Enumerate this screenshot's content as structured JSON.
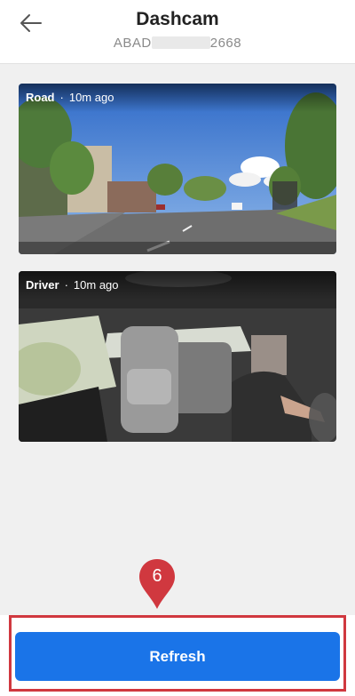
{
  "header": {
    "title": "Dashcam",
    "serial_prefix": "ABAD",
    "serial_suffix": "2668"
  },
  "cards": [
    {
      "name": "Road",
      "time": "10m ago"
    },
    {
      "name": "Driver",
      "time": "10m ago"
    }
  ],
  "actions": {
    "refresh_label": "Refresh"
  },
  "annotation": {
    "step_number": "6"
  },
  "colors": {
    "accent": "#1a74e8",
    "highlight": "#d0383f"
  }
}
